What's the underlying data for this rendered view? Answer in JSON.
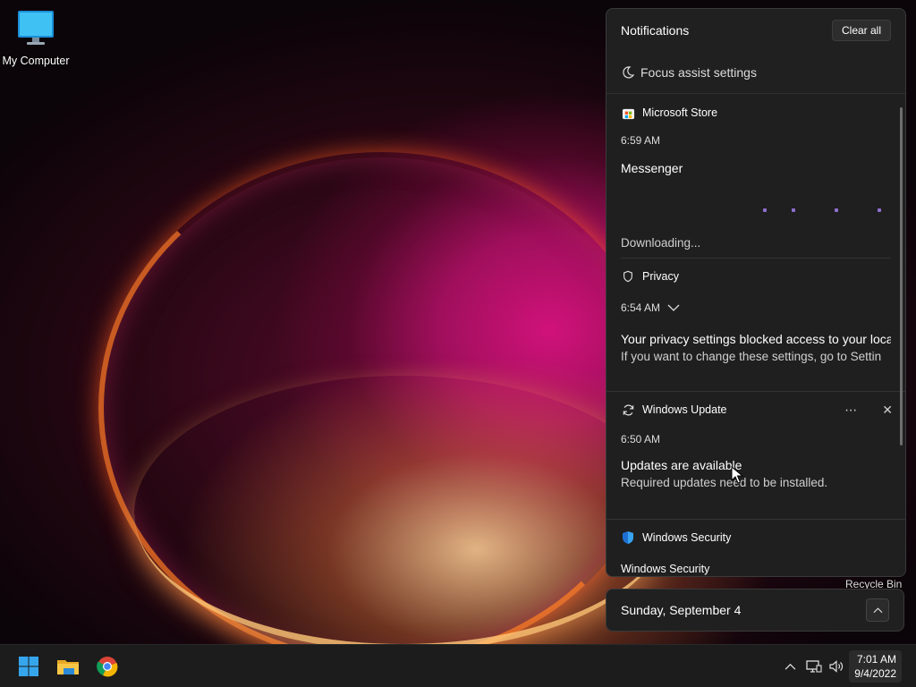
{
  "desktop": {
    "my_computer_label": "My Computer",
    "recycle_bin_label": "Recycle Bin"
  },
  "notification_center": {
    "title": "Notifications",
    "clear_all_label": "Clear all",
    "focus_assist_label": "Focus assist settings",
    "notifications": [
      {
        "app": "Microsoft Store",
        "app_icon": "microsoft-store-icon",
        "time": "6:59 AM",
        "title": "Messenger",
        "status": "Downloading..."
      },
      {
        "app": "Privacy",
        "app_icon": "shield-icon",
        "time": "6:54 AM",
        "title": "Your privacy settings blocked access to your locat",
        "body": "If you want to change these settings, go to Settin"
      },
      {
        "app": "Windows Update",
        "app_icon": "sync-icon",
        "time": "6:50 AM",
        "title": "Updates are available",
        "body": "Required updates need to be installed."
      },
      {
        "app": "Windows Security",
        "app_icon": "windows-security-shield-icon",
        "title": "Windows Security"
      }
    ]
  },
  "calendar": {
    "date_label": "Sunday, September 4"
  },
  "taskbar": {
    "pinned": [
      "start-icon",
      "file-explorer-icon",
      "chrome-icon"
    ],
    "tray_icons": [
      "chevron-up-icon",
      "network-icon",
      "volume-icon"
    ],
    "time": "7:01 AM",
    "date": "9/4/2022"
  },
  "colors": {
    "panel_bg": "#202020",
    "taskbar_bg": "#1c1c1c",
    "accent": "#0078d4",
    "progress_dots": "#8d6fd0"
  }
}
